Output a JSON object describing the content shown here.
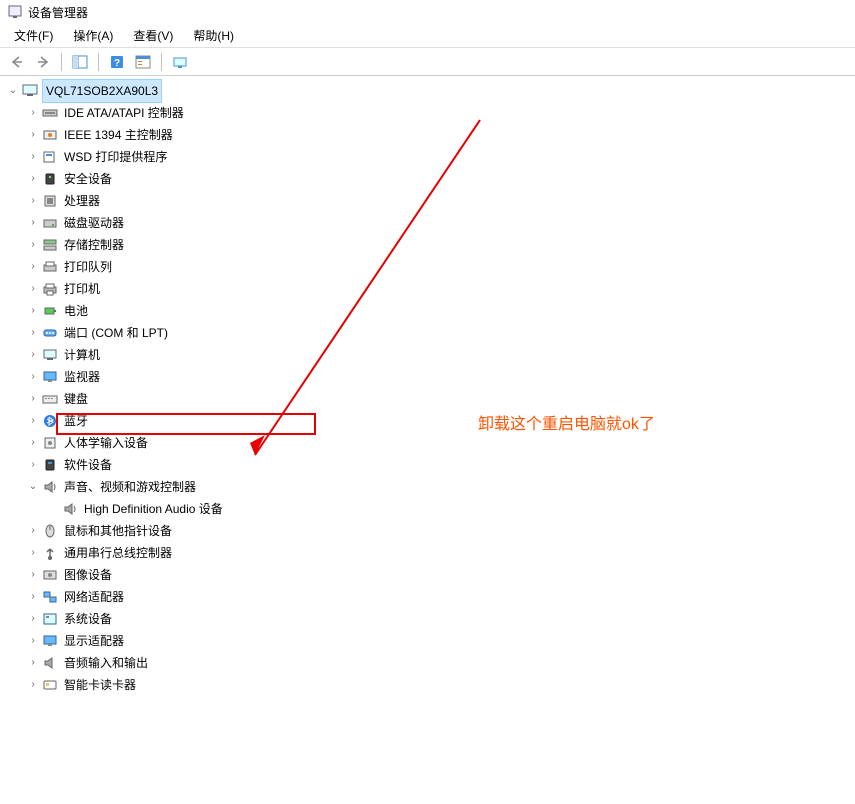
{
  "window": {
    "title": "设备管理器"
  },
  "menu": {
    "file": "文件(F)",
    "action": "操作(A)",
    "view": "查看(V)",
    "help": "帮助(H)"
  },
  "tree": {
    "root": "VQL71SOB2XA90L3",
    "items": [
      {
        "label": "IDE ATA/ATAPI 控制器",
        "icon": "ide"
      },
      {
        "label": "IEEE 1394 主控制器",
        "icon": "firewire"
      },
      {
        "label": "WSD 打印提供程序",
        "icon": "wsd"
      },
      {
        "label": "安全设备",
        "icon": "security"
      },
      {
        "label": "处理器",
        "icon": "cpu"
      },
      {
        "label": "磁盘驱动器",
        "icon": "disk"
      },
      {
        "label": "存储控制器",
        "icon": "storage"
      },
      {
        "label": "打印队列",
        "icon": "printqueue"
      },
      {
        "label": "打印机",
        "icon": "printer"
      },
      {
        "label": "电池",
        "icon": "battery"
      },
      {
        "label": "端口 (COM 和 LPT)",
        "icon": "port"
      },
      {
        "label": "计算机",
        "icon": "computer"
      },
      {
        "label": "监视器",
        "icon": "monitor"
      },
      {
        "label": "键盘",
        "icon": "keyboard"
      },
      {
        "label": "蓝牙",
        "icon": "bluetooth"
      },
      {
        "label": "人体学输入设备",
        "icon": "hid"
      },
      {
        "label": "软件设备",
        "icon": "software"
      },
      {
        "label": "声音、视频和游戏控制器",
        "icon": "sound",
        "expanded": true
      },
      {
        "label": "鼠标和其他指针设备",
        "icon": "mouse"
      },
      {
        "label": "通用串行总线控制器",
        "icon": "usb"
      },
      {
        "label": "图像设备",
        "icon": "image"
      },
      {
        "label": "网络适配器",
        "icon": "network"
      },
      {
        "label": "系统设备",
        "icon": "system"
      },
      {
        "label": "显示适配器",
        "icon": "display"
      },
      {
        "label": "音频输入和输出",
        "icon": "audio"
      },
      {
        "label": "智能卡读卡器",
        "icon": "smartcard"
      }
    ],
    "sound_child": "High Definition Audio 设备"
  },
  "annotation": "卸载这个重启电脑就ok了"
}
